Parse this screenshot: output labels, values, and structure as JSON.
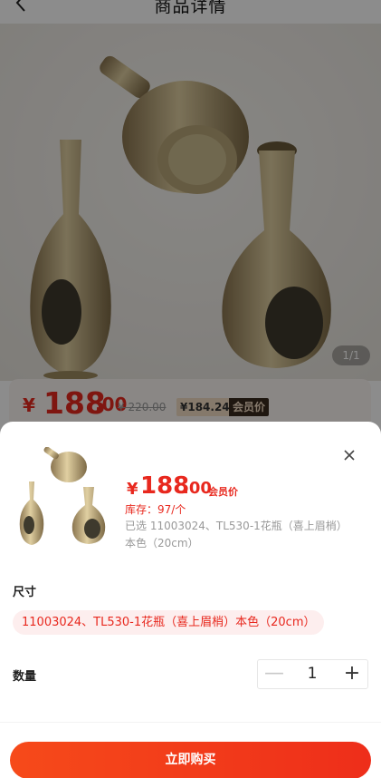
{
  "header": {
    "title": "商品详情",
    "back_icon": "chevron-left-icon"
  },
  "gallery": {
    "counter": "1/1"
  },
  "price_bar": {
    "currency": "¥",
    "price_int": "188",
    "price_dec": ".00",
    "original_price": "¥ 220.00",
    "member_price": "¥184.24",
    "member_tag": "会员价"
  },
  "sheet": {
    "close_icon": "close-icon",
    "price": {
      "currency": "¥",
      "int": "188",
      "dec": ".00",
      "tag": "会员价"
    },
    "stock": "库存：97/个",
    "selected": "已选   11003024、TL530-1花瓶（喜上眉梢）本色（20cm）",
    "size_label": "尺寸",
    "size_option": "11003024、TL530-1花瓶（喜上眉梢）本色（20cm）",
    "quantity_label": "数量",
    "quantity": "1",
    "minus": "—",
    "plus": "+",
    "buy_button": "立即购买"
  },
  "colors": {
    "accent": "#e8281e",
    "button_start": "#f64a1a",
    "button_end": "#ee2e1a",
    "chip_bg": "#fdeeee"
  }
}
